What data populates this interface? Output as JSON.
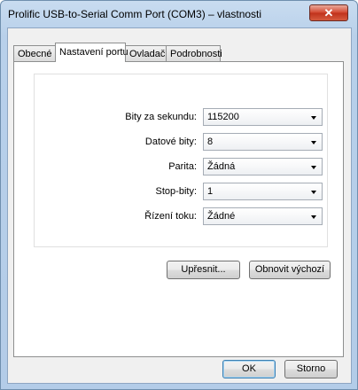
{
  "window": {
    "title": "Prolific USB-to-Serial Comm Port (COM3)  – vlastnosti",
    "close_glyph": "✕"
  },
  "tabs": [
    {
      "label": "Obecné",
      "active": false
    },
    {
      "label": "Nastavení portu",
      "active": true
    },
    {
      "label": "Ovladač",
      "active": false
    },
    {
      "label": "Podrobnosti",
      "active": false
    }
  ],
  "settings": [
    {
      "label": "Bity za sekundu:",
      "value": "115200"
    },
    {
      "label": "Datové bity:",
      "value": "8"
    },
    {
      "label": "Parita:",
      "value": "Žádná"
    },
    {
      "label": "Stop-bity:",
      "value": "1"
    },
    {
      "label": "Řízení toku:",
      "value": "Žádné"
    }
  ],
  "buttons": {
    "advanced": "Upřesnit...",
    "restore_defaults": "Obnovit výchozí",
    "ok": "OK",
    "cancel": "Storno"
  },
  "colors": {
    "title_bar": "#b8d0ea",
    "close_button": "#c0311b",
    "default_button_border": "#3c7fb1"
  }
}
